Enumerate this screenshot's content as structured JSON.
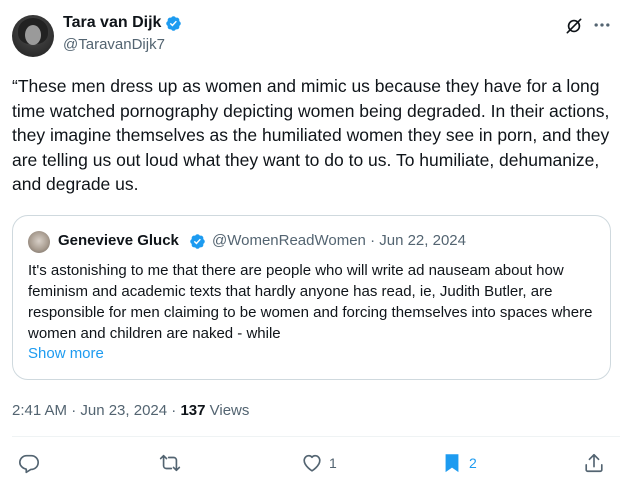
{
  "author": {
    "name": "Tara van Dijk",
    "handle": "@TaravanDijk7",
    "verified_icon": "verified-badge-icon"
  },
  "tweet": {
    "text": "“These men dress up as women and mimic us because they have for a long time watched pornography depicting women being degraded. In their actions, they imagine themselves as the humiliated women they see in porn, and they are telling us out loud what they want to do to us. To humiliate, dehumanize, and degrade us."
  },
  "quote": {
    "name": "Genevieve Gluck",
    "handle_date": "@WomenReadWomen · Jun 22, 2024",
    "text": "It's astonishing to me that there are people who will write ad nauseam about how feminism and academic texts that hardly anyone has read, ie, Judith Butler, are responsible for men claiming to be women and forcing themselves into spaces where women and children are naked - while",
    "show_more": "Show more"
  },
  "meta": {
    "time_date": "2:41 AM · Jun 23, 2024 · ",
    "views_count": "137",
    "views_label": " Views"
  },
  "actions": {
    "reply_count": "",
    "retweet_count": "",
    "like_count": "1",
    "bookmark_count": "2"
  },
  "colors": {
    "accent": "#1d9bf0",
    "secondary_text": "#536471",
    "primary_text": "#0f1419",
    "border": "#cfd9de"
  }
}
